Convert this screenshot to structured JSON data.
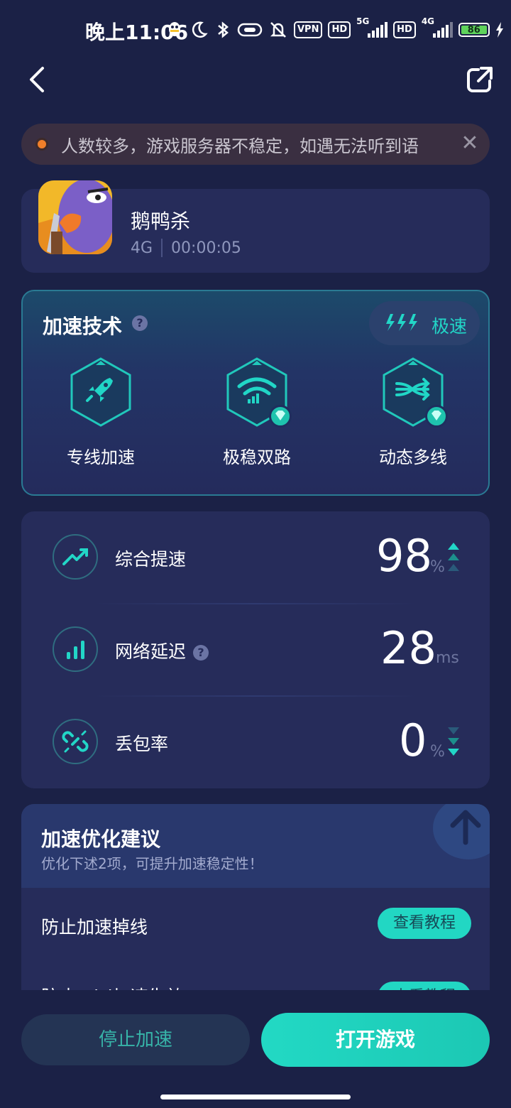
{
  "status_bar": {
    "time": "晚上11:06",
    "vpn": "VPN",
    "hd": "HD",
    "net1": "5G",
    "net2": "4G",
    "battery": "86"
  },
  "notice": {
    "text": "人数较多，游戏服务器不稳定，如遇无法听到语"
  },
  "game": {
    "title": "鹅鸭杀",
    "network": "4G",
    "timer": "00:00:05"
  },
  "tech": {
    "title": "加速技术",
    "mode_label": "极速",
    "features": [
      {
        "name": "专线加速",
        "icon": "rocket-icon"
      },
      {
        "name": "极稳双路",
        "icon": "wifi-icon"
      },
      {
        "name": "动态多线",
        "icon": "multiline-icon"
      }
    ]
  },
  "stats": {
    "boost": {
      "label": "综合提速",
      "value": "98",
      "unit": "%"
    },
    "latency": {
      "label": "网络延迟",
      "value": "28",
      "unit": "ms"
    },
    "loss": {
      "label": "丢包率",
      "value": "0",
      "unit": "%"
    }
  },
  "suggestions": {
    "title": "加速优化建议",
    "subtitle": "优化下述2项，可提升加速稳定性！",
    "items": [
      {
        "label": "防止加速掉线",
        "button": "查看教程"
      },
      {
        "label": "防止WiFi加速失效",
        "button": "查看教程"
      }
    ]
  },
  "actions": {
    "stop": "停止加速",
    "open": "打开游戏"
  },
  "colors": {
    "background": "#1b2146",
    "accent": "#22d7c3",
    "card": "#262c5a"
  }
}
